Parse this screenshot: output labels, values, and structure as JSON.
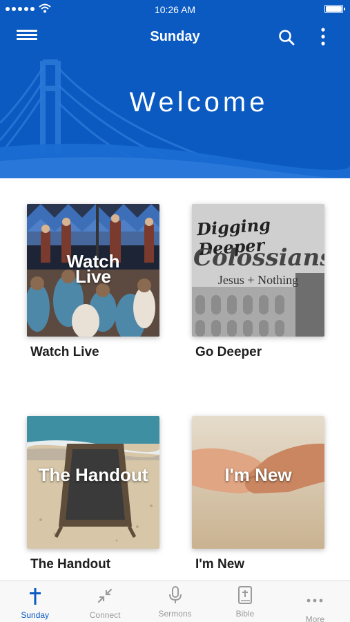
{
  "status_bar": {
    "time": "10:26 AM",
    "signal_icon": "signal-dots-icon",
    "wifi_icon": "wifi-icon",
    "battery_icon": "battery-icon"
  },
  "header": {
    "title": "Sunday",
    "welcome": "Welcome",
    "menu_icon": "hamburger-menu-icon",
    "search_icon": "search-icon",
    "more_icon": "more-vertical-icon",
    "background_color": "#0a5ac2"
  },
  "tiles": [
    {
      "label": "Watch Live",
      "overlay": [
        "Watch",
        "Live"
      ]
    },
    {
      "label": "Go Deeper",
      "overlay_lines": [
        "Digging Deeper",
        "Colossians",
        "Jesus + Nothing"
      ]
    },
    {
      "label": "The Handout",
      "overlay": "The Handout"
    },
    {
      "label": "I'm New",
      "overlay": "I'm New"
    }
  ],
  "tab_bar": {
    "active_color": "#0a5ac2",
    "inactive_color": "#9a9a9a",
    "tabs": [
      {
        "label": "Sunday",
        "icon": "cross-icon",
        "active": true
      },
      {
        "label": "Connect",
        "icon": "compress-arrows-icon",
        "active": false
      },
      {
        "label": "Sermons",
        "icon": "microphone-icon",
        "active": false
      },
      {
        "label": "Bible",
        "icon": "bible-icon",
        "active": false
      },
      {
        "label": "More",
        "icon": "more-horizontal-icon",
        "active": false
      }
    ]
  }
}
